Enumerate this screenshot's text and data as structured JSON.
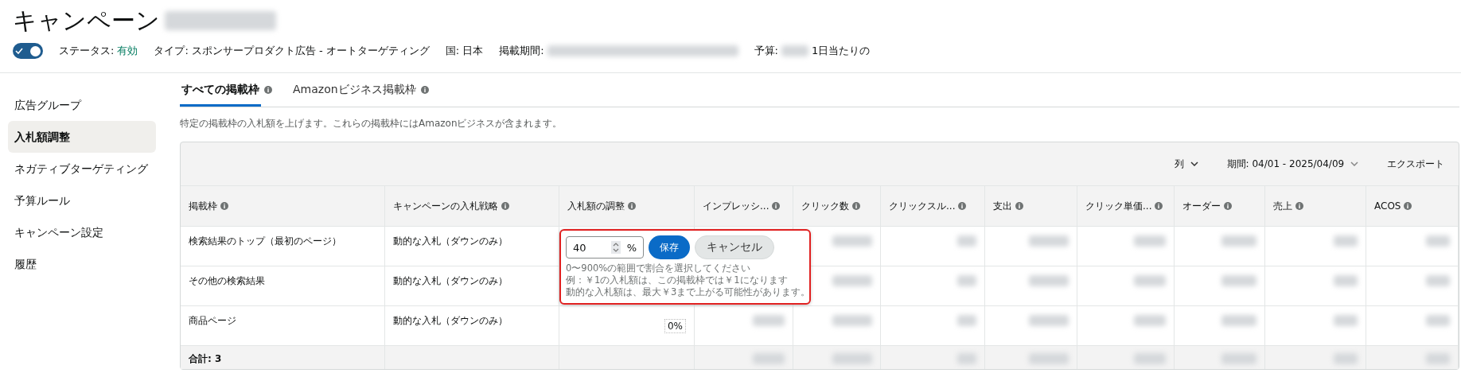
{
  "header": {
    "title": "キャンペーン",
    "status_toggle": {
      "on": true
    },
    "meta": [
      {
        "label": "ステータス:",
        "value": "有効",
        "kind": "status"
      },
      {
        "label": "タイプ:",
        "value": "スポンサープロダクト広告 - オートターゲティング",
        "kind": "plain"
      },
      {
        "label": "国:",
        "value": "日本",
        "kind": "plain"
      },
      {
        "label": "掲載期間:",
        "kind": "hidden"
      },
      {
        "label": "予算:",
        "value": "1日当たりの",
        "kind": "hidden_prefix"
      }
    ]
  },
  "sidebar": {
    "items": [
      {
        "label": "広告グループ",
        "selected": false
      },
      {
        "label": "入札額調整",
        "selected": true
      },
      {
        "label": "ネガティブターゲティング",
        "selected": false
      },
      {
        "label": "予算ルール",
        "selected": false
      },
      {
        "label": "キャンペーン設定",
        "selected": false
      },
      {
        "label": "履歴",
        "selected": false
      }
    ]
  },
  "tabs": [
    {
      "label": "すべての掲載枠",
      "selected": true
    },
    {
      "label": "Amazonビジネス掲載枠",
      "selected": false
    }
  ],
  "description": "特定の掲載枠の入札額を上げます。これらの掲載枠にはAmazonビジネスが含まれます。",
  "toolbar": {
    "columns_button": "列",
    "date_range": "期間: 04/01 - 2025/04/09",
    "export_button": "エクスポート"
  },
  "table": {
    "columns": [
      "掲載枠",
      "キャンペーンの入札戦略",
      "入札額の調整",
      "インプレッシ...",
      "クリック数",
      "クリックスル...",
      "支出",
      "クリック単価...",
      "オーダー",
      "売上",
      "ACOS"
    ],
    "rows": [
      {
        "placement": "検索結果のトップ（最初のページ）",
        "strategy": "動的な入札（ダウンのみ）"
      },
      {
        "placement": "その他の検索結果",
        "strategy": "動的な入札（ダウンのみ）"
      },
      {
        "placement": "商品ページ",
        "strategy": "動的な入札（ダウンのみ）",
        "adjustment": "0%"
      }
    ],
    "total": "合計: 3"
  },
  "editor": {
    "value": "40",
    "unit": "%",
    "save": "保存",
    "cancel": "キャンセル",
    "hints": [
      "0〜900%の範囲で割合を選択してください",
      "例：￥1の入札額は、この掲載枠では￥1になります",
      "動的な入札額は、最大￥3まで上がる可能性があります。"
    ]
  }
}
